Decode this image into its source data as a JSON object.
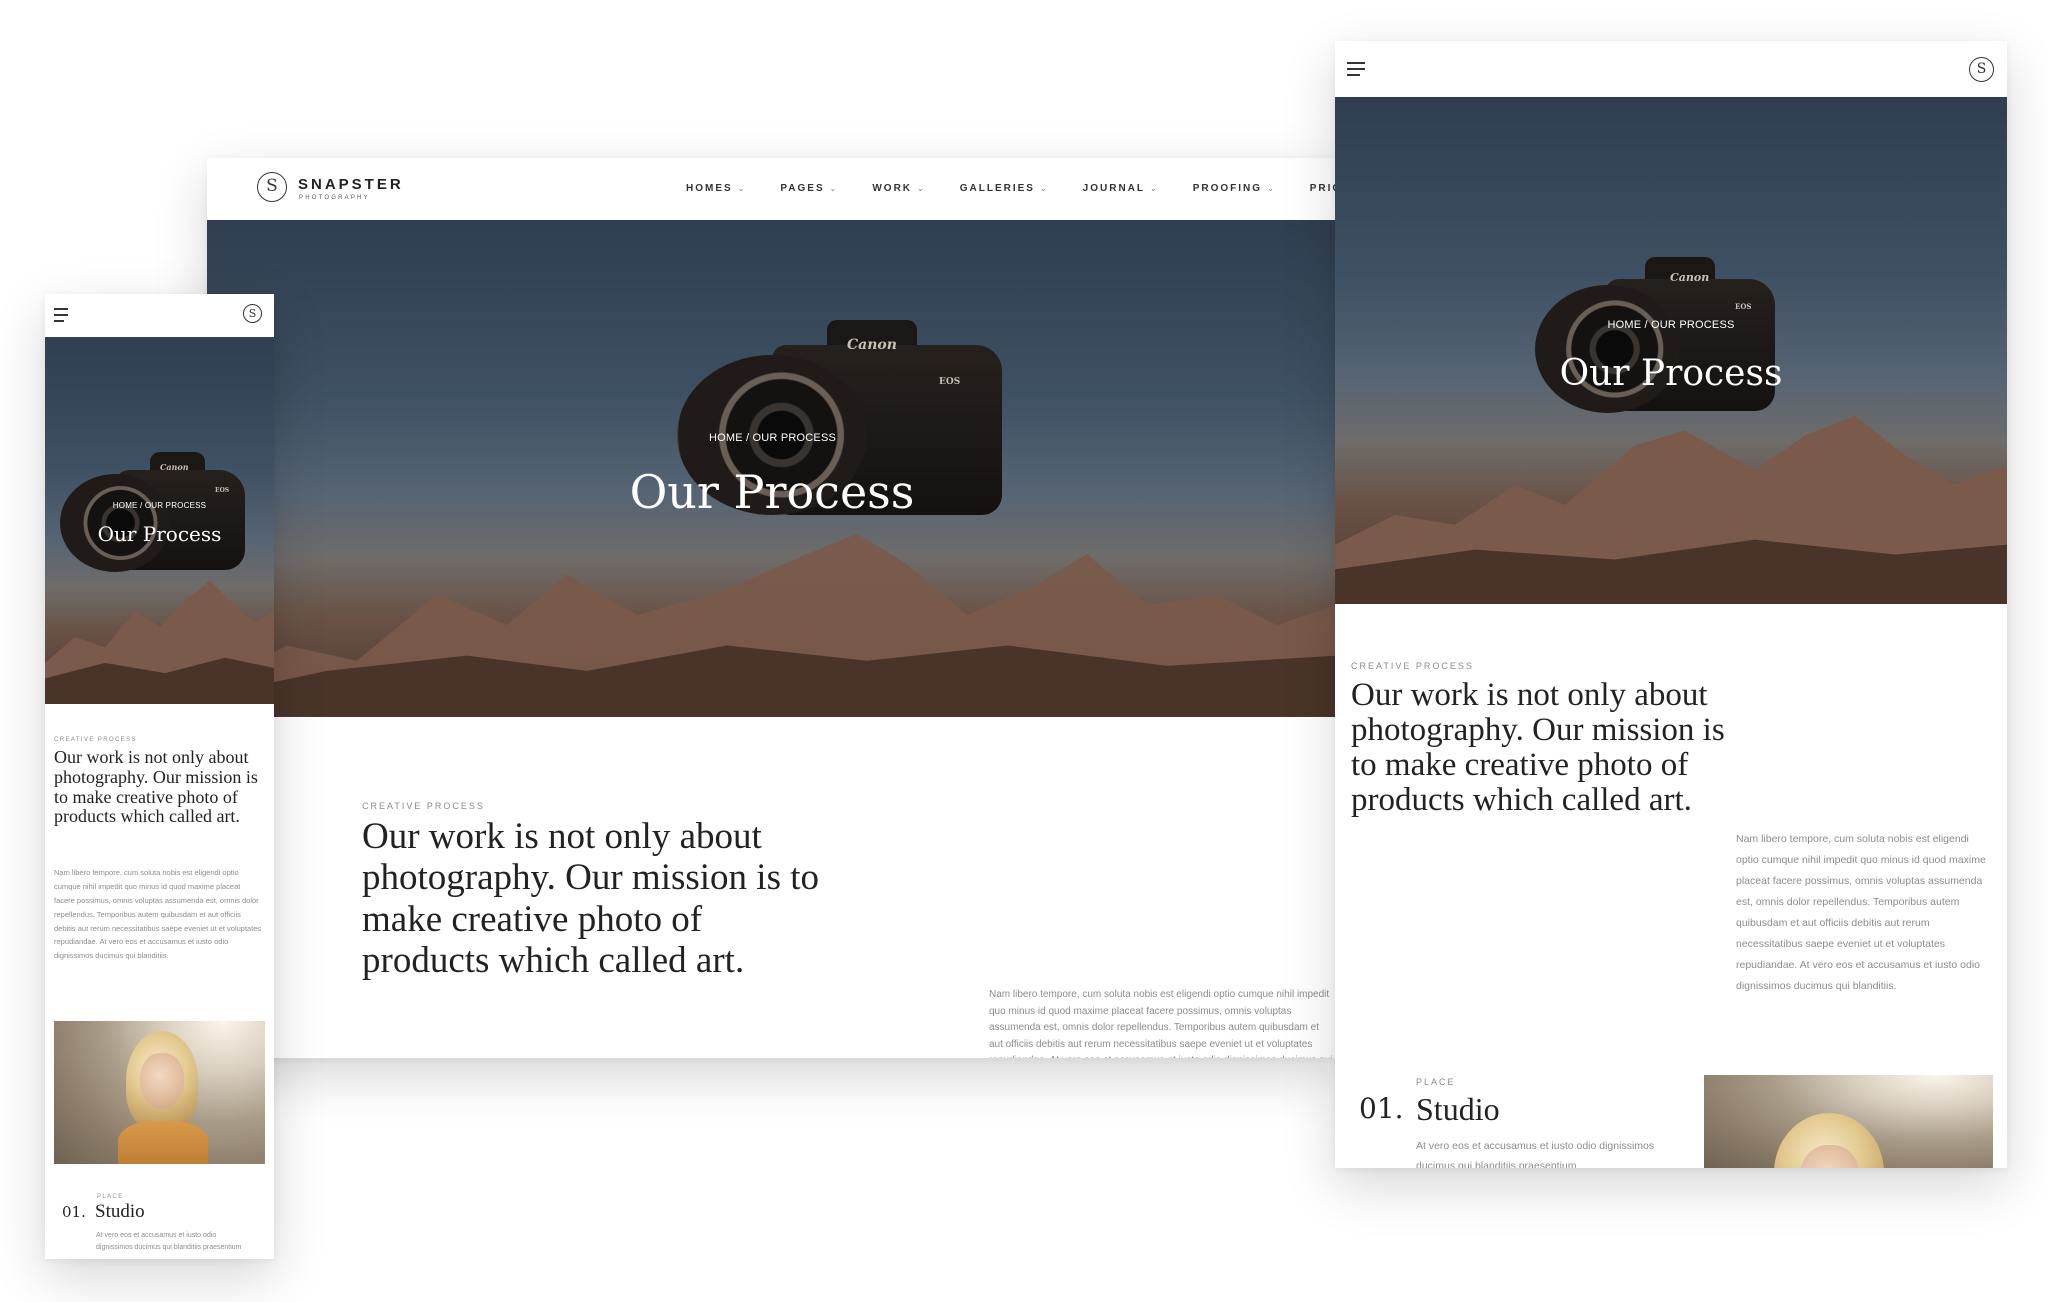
{
  "brand": {
    "name": "SNAPSTER",
    "tagline": "PHOTOGRAPHY",
    "monogram": "S"
  },
  "nav": {
    "items": [
      {
        "label": "HOMES"
      },
      {
        "label": "PAGES"
      },
      {
        "label": "WORK"
      },
      {
        "label": "GALLERIES"
      },
      {
        "label": "JOURNAL"
      },
      {
        "label": "PROOFING"
      },
      {
        "label": "PRICING"
      }
    ],
    "chevron": "⌄"
  },
  "hero": {
    "breadcrumb": "HOME / OUR PROCESS",
    "title": "Our Process",
    "camera_brand": "Canon",
    "camera_model": "EOS"
  },
  "content": {
    "eyebrow": "CREATIVE PROCESS",
    "heading": "Our work is not only about photography. Our mission is to make creative photo of products which called art.",
    "body": "Nam libero tempore, cum soluta nobis est eligendi optio cumque nihil impedit quo minus id quod maxime placeat facere possimus, omnis voluptas assumenda est, omnis dolor repellendus. Temporibus autem quibusdam et aut officiis debitis aut rerum necessitatibus saepe eveniet ut et voluptates repudiandae. At vero eos et accusamus et iusto odio dignissimos ducimus qui blanditiis."
  },
  "process": {
    "label": "PLACE",
    "number": "01.",
    "title": "Studio",
    "text": "At vero eos et accusamus et iusto odio dignissimos ducimus qui blanditiis praesentium"
  },
  "colors": {
    "accent": "#222222",
    "muted_text": "#8c8c8c",
    "sky": "#3e5063",
    "rock": "#6a5246"
  },
  "icons": {
    "menu": "hamburger-icon",
    "logo": "monogram-s-icon",
    "dropdown": "chevron-down-icon"
  }
}
